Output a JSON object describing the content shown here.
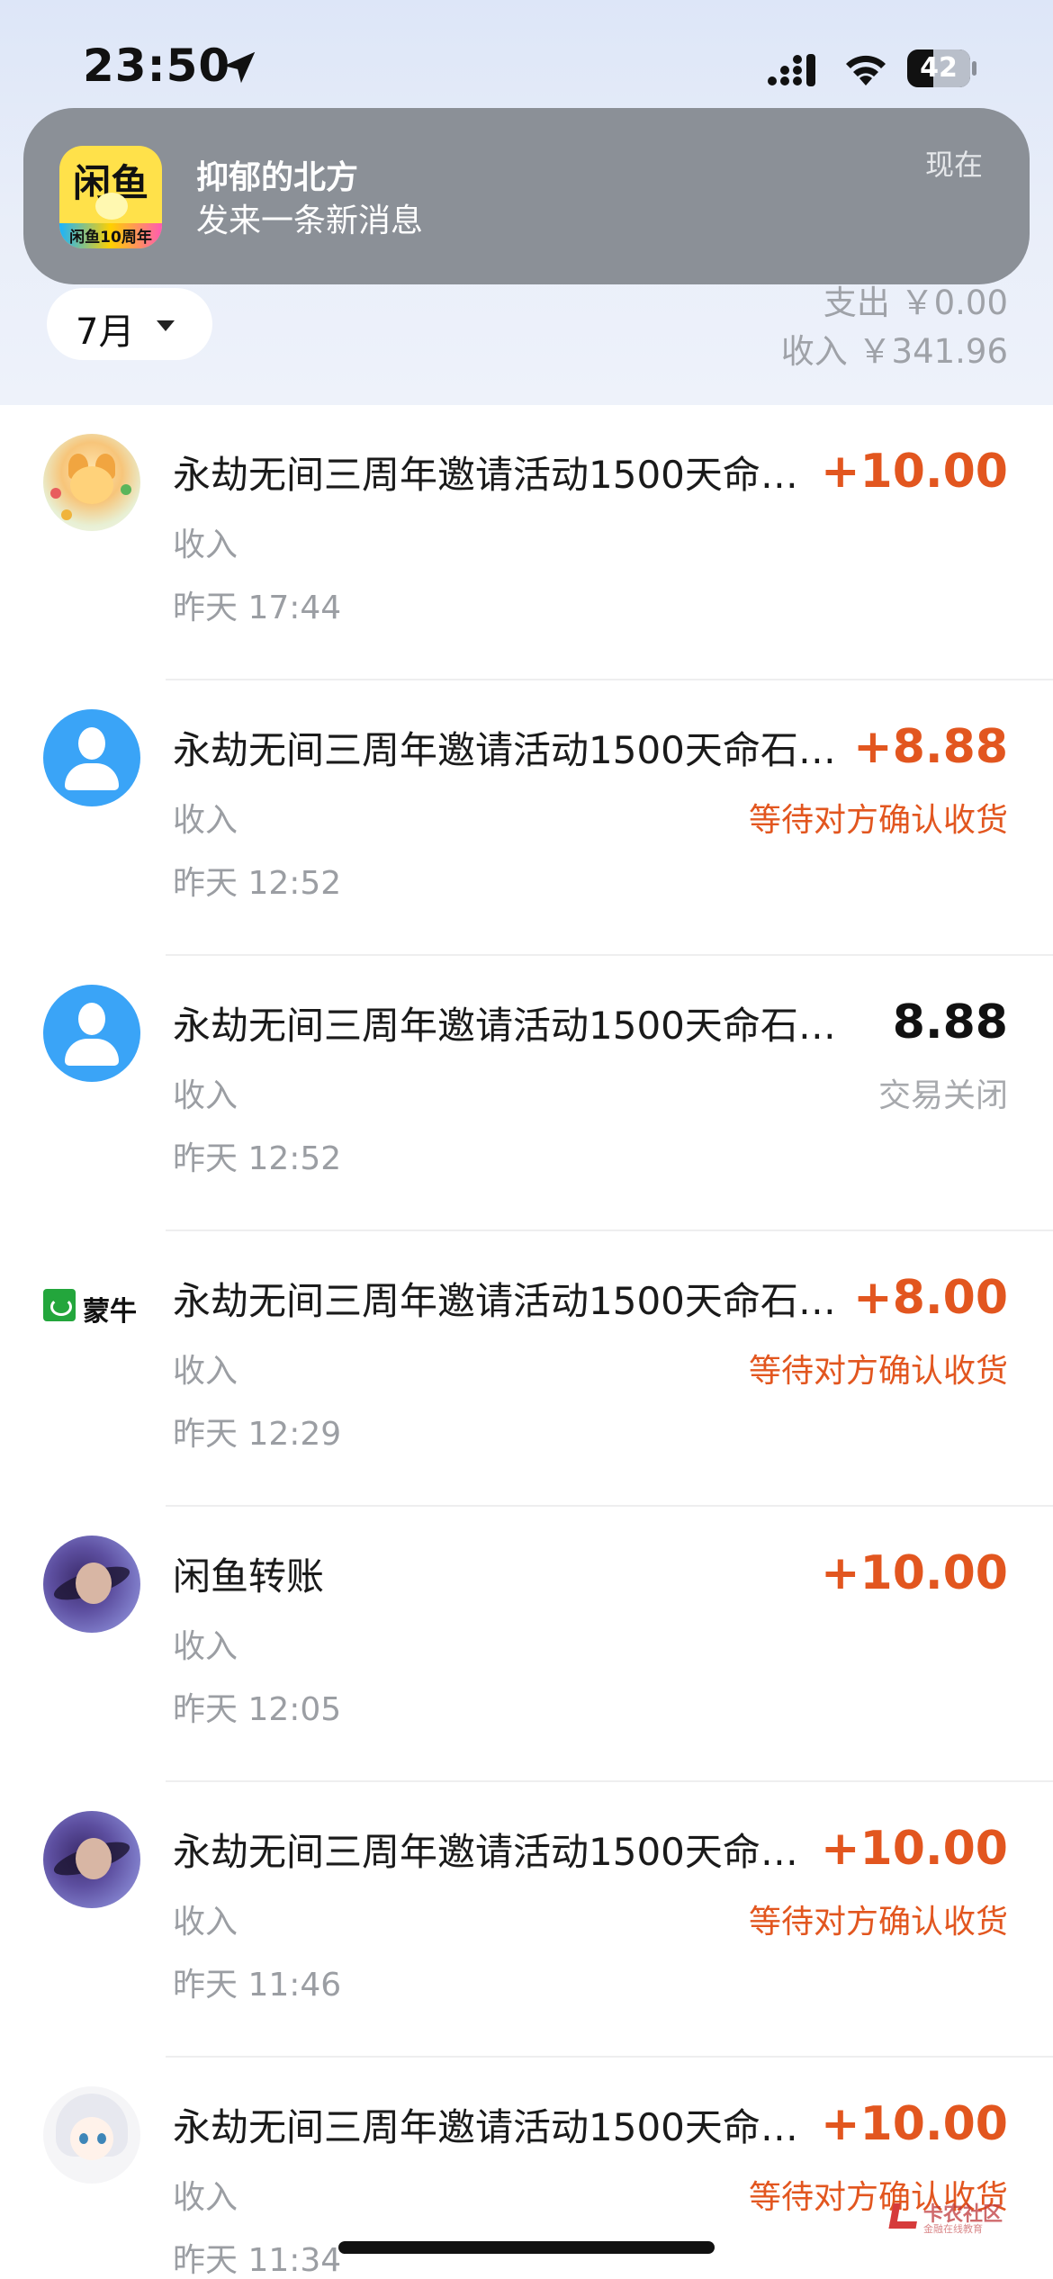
{
  "status_bar": {
    "time": "23:50",
    "battery": "42",
    "battery_level_percent": 42
  },
  "notification": {
    "app_logo_text": "闲鱼",
    "app_badge_text": "闲鱼10周年",
    "title": "抑郁的北方",
    "body": "发来一条新消息",
    "time": "现在"
  },
  "filter": {
    "month": "7月"
  },
  "summary": {
    "expense": "支出 ￥0.00",
    "income": "收入 ￥341.96"
  },
  "colors": {
    "accent": "#e2561f",
    "muted": "#9b9ea3",
    "avatar_blue": "#3aa4f7"
  },
  "transactions": [
    {
      "avatar": "festival-cat-avatar",
      "title": "永劫无间三周年邀请活动1500天命…",
      "type": "收入",
      "time": "昨天 17:44",
      "amount": "+10.00",
      "status": ""
    },
    {
      "avatar": "default-user-avatar",
      "title": "永劫无间三周年邀请活动1500天命石…",
      "type": "收入",
      "time": "昨天 12:52",
      "amount": "+8.88",
      "status": "等待对方确认收货"
    },
    {
      "avatar": "default-user-avatar",
      "title": "永劫无间三周年邀请活动1500天命石…",
      "type": "收入",
      "time": "昨天 12:52",
      "amount": "8.88",
      "status": "交易关闭"
    },
    {
      "avatar": "mengniu-brand-logo",
      "brand_text": "蒙牛",
      "title": "永劫无间三周年邀请活动1500天命石…",
      "type": "收入",
      "time": "昨天 12:29",
      "amount": "+8.00",
      "status": "等待对方确认收货"
    },
    {
      "avatar": "photo-avatar",
      "title": "闲鱼转账",
      "type": "收入",
      "time": "昨天 12:05",
      "amount": "+10.00",
      "status": ""
    },
    {
      "avatar": "photo-avatar",
      "title": "永劫无间三周年邀请活动1500天命…",
      "type": "收入",
      "time": "昨天 11:46",
      "amount": "+10.00",
      "status": "等待对方确认收货"
    },
    {
      "avatar": "anime-girl-avatar",
      "title": "永劫无间三周年邀请活动1500天命…",
      "type": "收入",
      "time": "昨天 11:34",
      "amount": "+10.00",
      "status": "等待对方确认收货"
    }
  ],
  "watermark": {
    "text": "卡农社区",
    "subtext": "金融在线教育"
  }
}
